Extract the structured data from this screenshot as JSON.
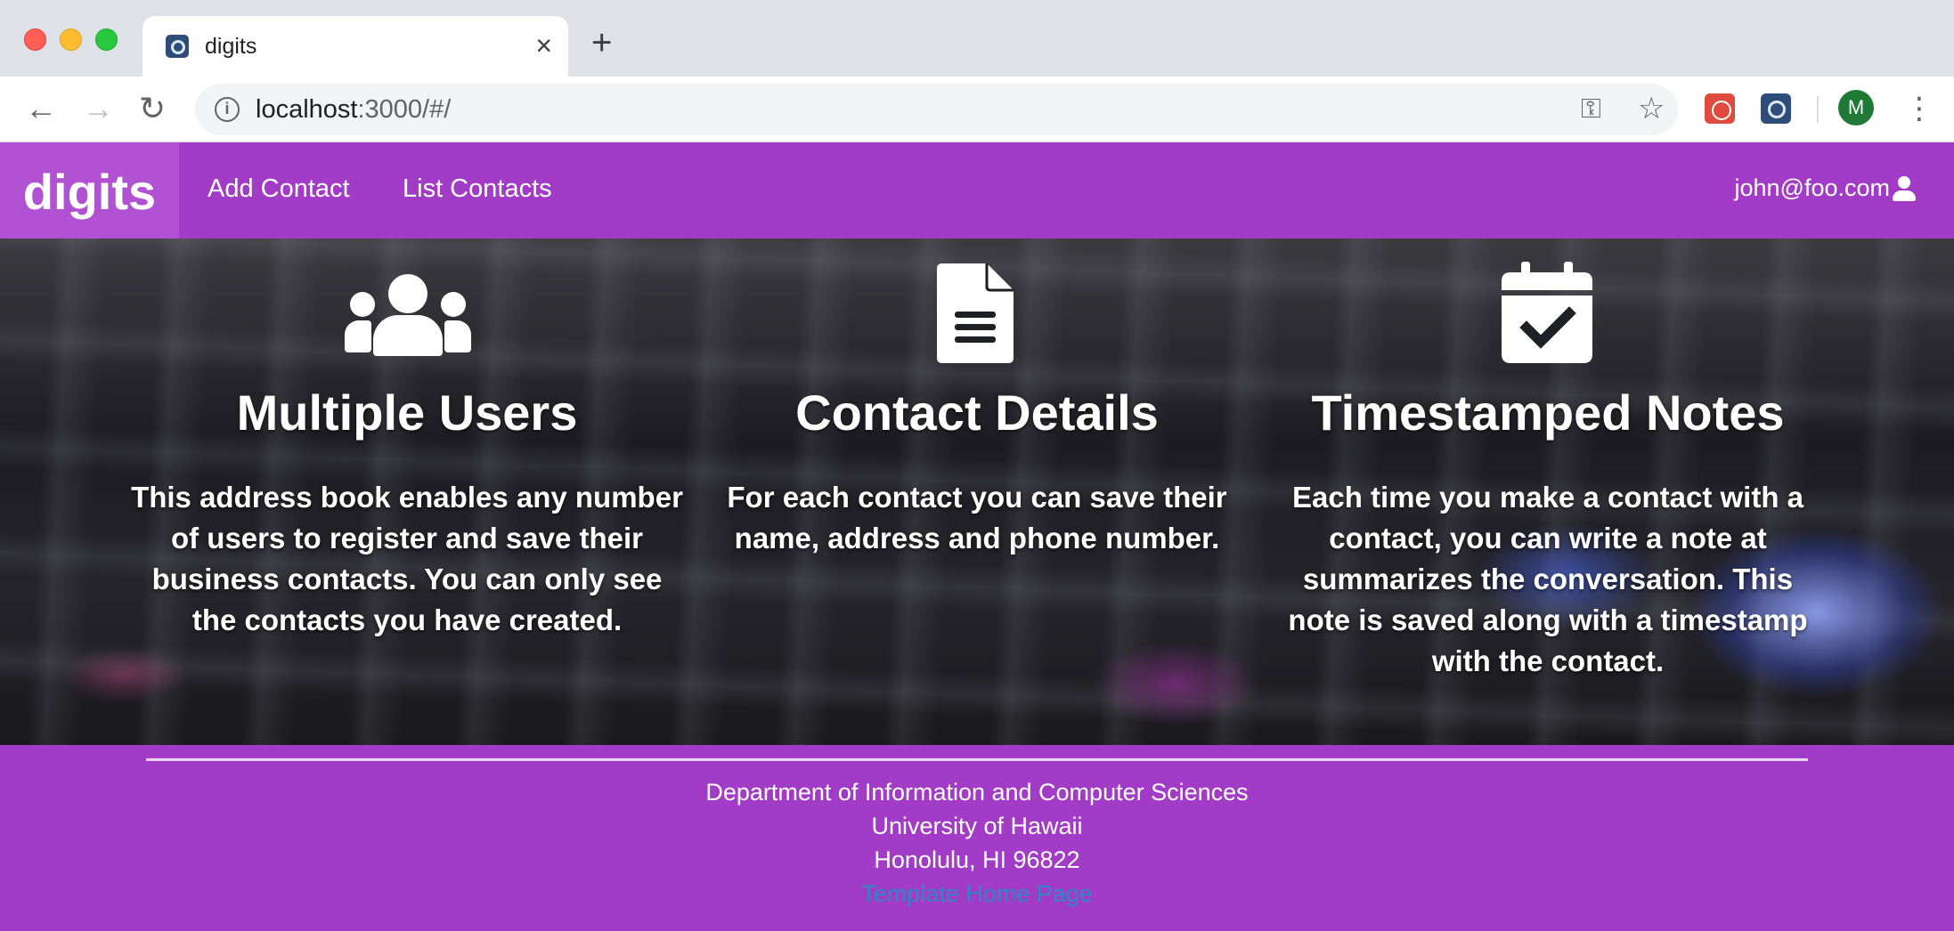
{
  "browser": {
    "tab_title": "digits",
    "new_tab_symbol": "+",
    "close_symbol": "×",
    "url_host": "localhost",
    "url_rest": ":3000/#/",
    "profile_initial": "M",
    "icons": {
      "back": "back-arrow-icon",
      "forward": "forward-arrow-icon",
      "reload": "reload-icon",
      "info": "info-icon",
      "key": "key-icon",
      "bookmark": "star-icon",
      "menu": "kebab-menu-icon"
    }
  },
  "navbar": {
    "brand": "digits",
    "links": [
      "Add Contact",
      "List Contacts"
    ],
    "user": "john@foo.com",
    "accent_color": "#a23cc6"
  },
  "features": [
    {
      "icon": "users-icon",
      "title": "Multiple Users",
      "text": "This address book enables any number of users to register and save their business contacts. You can only see the contacts you have created."
    },
    {
      "icon": "file-alt-icon",
      "title": "Contact Details",
      "text": "For each contact you can save their name, address and phone number."
    },
    {
      "icon": "calendar-check-icon",
      "title": "Timestamped Notes",
      "text": "Each time you make a contact with a contact, you can write a note at summarizes the conversation. This note is saved along with a timestamp with the contact."
    }
  ],
  "footer": {
    "lines": [
      "Department of Information and Computer Sciences",
      "University of Hawaii",
      "Honolulu, HI 96822"
    ],
    "link": "Template Home Page",
    "link_color": "#2f86c6"
  }
}
